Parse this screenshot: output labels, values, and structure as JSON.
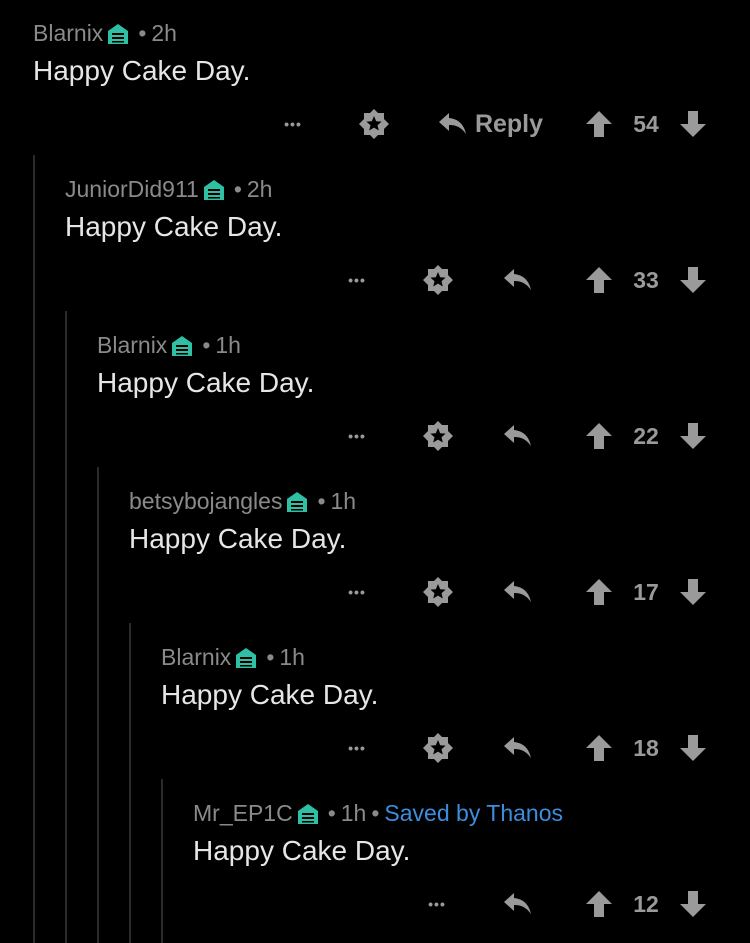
{
  "colors": {
    "background": "#000000",
    "flair": "#2ebfa5",
    "meta_text": "#8a8a8a",
    "body_text": "#e6e6e6",
    "saved_link": "#3d8ddf",
    "icon": "#9a9a9a"
  },
  "icons": {
    "flair": "flair-icon",
    "more": "more-options-icon",
    "award": "award-icon",
    "reply": "reply-icon",
    "upvote": "upvote-icon",
    "downvote": "downvote-icon"
  },
  "comments": [
    {
      "author": "Blarnix",
      "sep": "•",
      "time": "2h",
      "body": "Happy Cake Day.",
      "more": "•••",
      "reply_label": "Reply",
      "score": "54"
    },
    {
      "author": "JuniorDid911",
      "sep": "•",
      "time": "2h",
      "body": "Happy Cake Day.",
      "more": "•••",
      "score": "33"
    },
    {
      "author": "Blarnix",
      "sep": "•",
      "time": "1h",
      "body": "Happy Cake Day.",
      "more": "•••",
      "score": "22"
    },
    {
      "author": "betsybojangles",
      "sep": "•",
      "time": "1h",
      "body": "Happy Cake Day.",
      "more": "•••",
      "score": "17"
    },
    {
      "author": "Blarnix",
      "sep": "•",
      "time": "1h",
      "body": "Happy Cake Day.",
      "more": "•••",
      "score": "18"
    },
    {
      "author": "Mr_EP1C",
      "sep": "•",
      "time": "1h",
      "sep2": "•",
      "saved": "Saved by Thanos",
      "body": "Happy Cake Day.",
      "more": "•••",
      "score": "12"
    }
  ]
}
